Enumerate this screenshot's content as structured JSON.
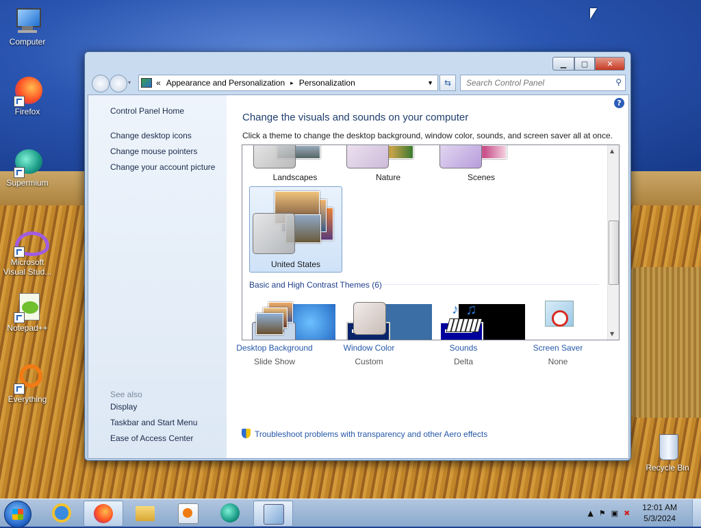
{
  "desktop": {
    "icons": [
      {
        "label": "Computer"
      },
      {
        "label": "Firefox"
      },
      {
        "label": "Supermium"
      },
      {
        "label": "Microsoft Visual Stud..."
      },
      {
        "label": "Notepad++"
      },
      {
        "label": "Everything"
      },
      {
        "label": "Recycle Bin"
      }
    ]
  },
  "window": {
    "breadcrumb": {
      "prefix": "«",
      "items": [
        "Appearance and Personalization",
        "Personalization"
      ],
      "separator": "▸"
    },
    "search_placeholder": "Search Control Panel",
    "sidebar": {
      "home": "Control Panel Home",
      "links": [
        "Change desktop icons",
        "Change mouse pointers",
        "Change your account picture"
      ],
      "see_also_title": "See also",
      "see_also": [
        "Display",
        "Taskbar and Start Menu",
        "Ease of Access Center"
      ]
    },
    "main": {
      "title": "Change the visuals and sounds on your computer",
      "subtitle": "Click a theme to change the desktop background, window color, sounds, and screen saver all at once.",
      "themes_row1": [
        "Landscapes",
        "Nature",
        "Scenes"
      ],
      "selected_theme": "United States",
      "group_title": "Basic and High Contrast Themes (6)"
    },
    "tiles": [
      {
        "label": "Desktop Background",
        "value": "Slide Show"
      },
      {
        "label": "Window Color",
        "value": "Custom"
      },
      {
        "label": "Sounds",
        "value": "Delta"
      },
      {
        "label": "Screen Saver",
        "value": "None"
      }
    ],
    "troubleshoot": "Troubleshoot problems with transparency and other Aero effects"
  },
  "taskbar": {
    "time": "12:01 AM",
    "date": "5/3/2024"
  },
  "colors": {
    "link": "#2456a8",
    "title": "#1e3d6b",
    "close": "#c73a23"
  }
}
